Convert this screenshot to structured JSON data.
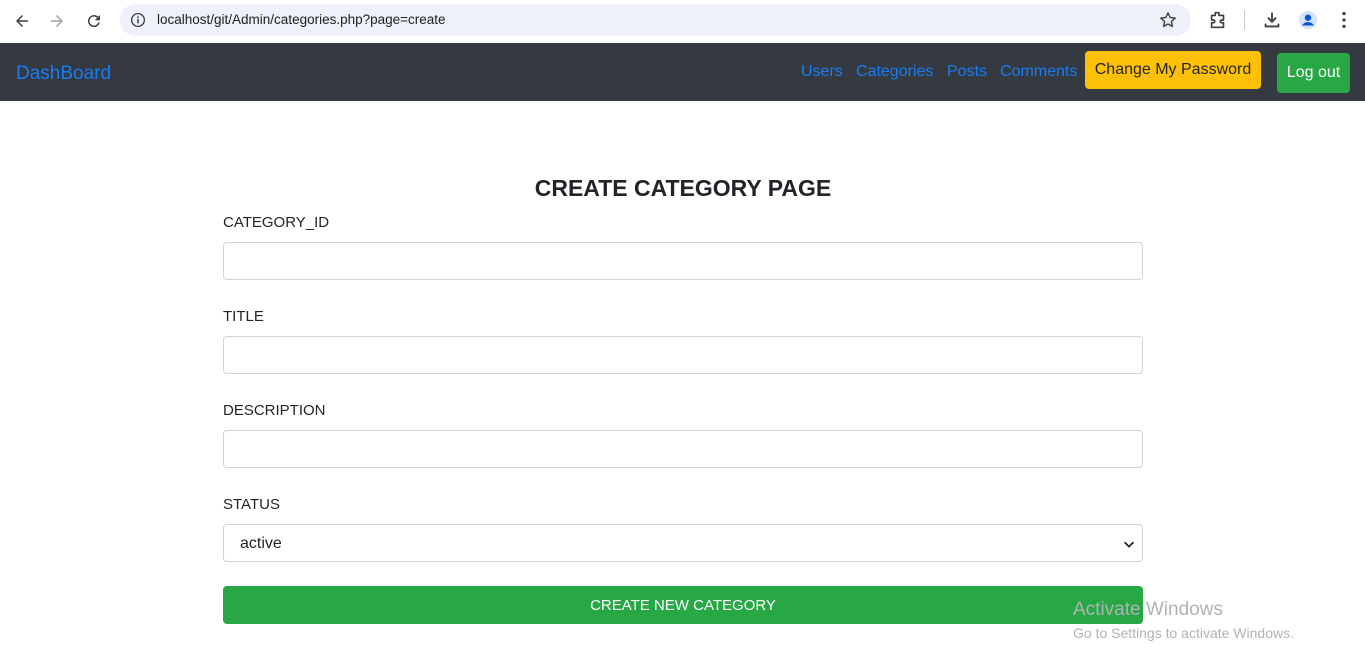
{
  "browser": {
    "url": "localhost/git/Admin/categories.php?page=create"
  },
  "navbar": {
    "brand": "DashBoard",
    "links": [
      "Users",
      "Categories",
      "Posts",
      "Comments"
    ],
    "change_password": "Change My Password",
    "logout": "Log out"
  },
  "form": {
    "title": "CREATE CATEGORY PAGE",
    "fields": [
      {
        "label": "CATEGORY_ID",
        "value": ""
      },
      {
        "label": "TITLE",
        "value": ""
      },
      {
        "label": "DESCRIPTION",
        "value": ""
      }
    ],
    "status_label": "STATUS",
    "status_value": "active",
    "submit": "CREATE NEW CATEGORY"
  },
  "watermark": {
    "title": "Activate Windows",
    "subtitle": "Go to Settings to activate Windows."
  },
  "colors": {
    "navbar_bg": "#343a40",
    "link": "#1a7cf5",
    "warning": "#ffc107",
    "success": "#28a745"
  }
}
